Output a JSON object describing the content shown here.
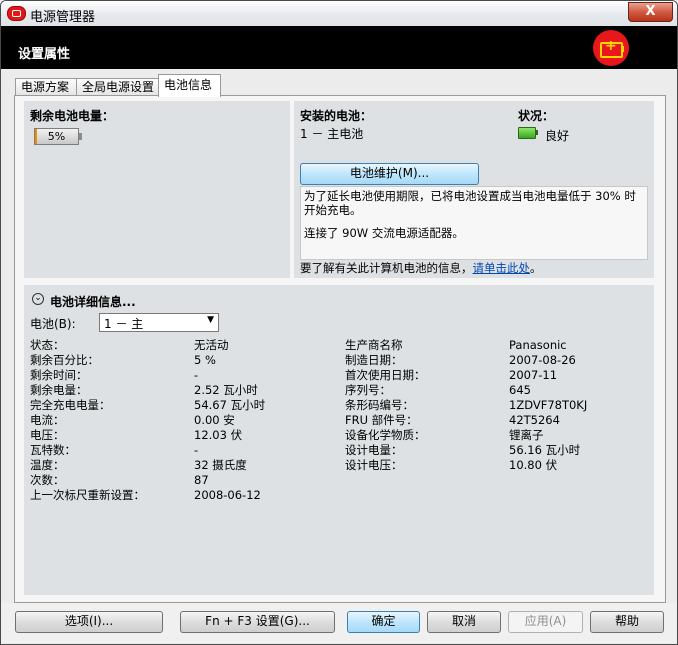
{
  "window": {
    "title": "电源管理器",
    "close_label": "X"
  },
  "header": {
    "title": "设置属性"
  },
  "tabs": [
    {
      "label": "电源方案"
    },
    {
      "label": "全局电源设置"
    },
    {
      "label": "电池信息"
    }
  ],
  "remaining": {
    "title": "剩余电池电量：",
    "percent_label": "5%",
    "level": 0.05
  },
  "installed": {
    "title": "安装的电池：",
    "battery": "1 － 主电池"
  },
  "status": {
    "title": "状况：",
    "value": "良好"
  },
  "maintenance_button": "电池维护(M)...",
  "info": {
    "line1": "为了延长电池使用期限，已将电池设置成当电池电量低于 30% 时开始充电。",
    "line2": "连接了 90W 交流电源适配器。",
    "more_text": "要了解有关此计算机电池的信息，",
    "link_text": "请单击此处",
    "after_link": "。"
  },
  "details": {
    "title": "电池详细信息...",
    "battery_select_label": "电池(B):",
    "battery_select_value": "1 － 主",
    "left_rows": [
      {
        "label": "状态：",
        "value": "无活动"
      },
      {
        "label": "剩余百分比：",
        "value": "5 %"
      },
      {
        "label": "剩余时间：",
        "value": "-"
      },
      {
        "label": "剩余电量：",
        "value": "2.52 瓦小时"
      },
      {
        "label": "完全充电电量：",
        "value": "54.67 瓦小时"
      },
      {
        "label": "电流：",
        "value": "0.00 安"
      },
      {
        "label": "电压：",
        "value": "12.03 伏"
      },
      {
        "label": "瓦特数：",
        "value": "-"
      },
      {
        "label": "温度：",
        "value": "32 摄氏度"
      },
      {
        "label": "次数：",
        "value": "87"
      },
      {
        "label": "上一次标尺重新设置：",
        "value": "2008-06-12"
      }
    ],
    "right_rows": [
      {
        "label": "生产商名称",
        "value": "Panasonic"
      },
      {
        "label": "制造日期：",
        "value": "2007-08-26"
      },
      {
        "label": "首次使用日期：",
        "value": "2007-11"
      },
      {
        "label": "序列号：",
        "value": "645"
      },
      {
        "label": "条形码编号：",
        "value": "1ZDVF78T0KJ"
      },
      {
        "label": "FRU 部件号：",
        "value": "42T5264"
      },
      {
        "label": "设备化学物质：",
        "value": "锂离子"
      },
      {
        "label": "设计电量：",
        "value": "56.16 瓦小时"
      },
      {
        "label": "设计电压：",
        "value": "10.80 伏"
      }
    ]
  },
  "buttons": {
    "options": "选项(I)...",
    "fn_f3": "Fn + F3 设置(G)...",
    "ok": "确定",
    "cancel": "取消",
    "apply": "应用(A)",
    "help": "帮助"
  },
  "colors": {
    "banner": "#000000",
    "logo_red": "#e8171b",
    "link": "#0047b3",
    "status_green": "#3aa51c"
  }
}
